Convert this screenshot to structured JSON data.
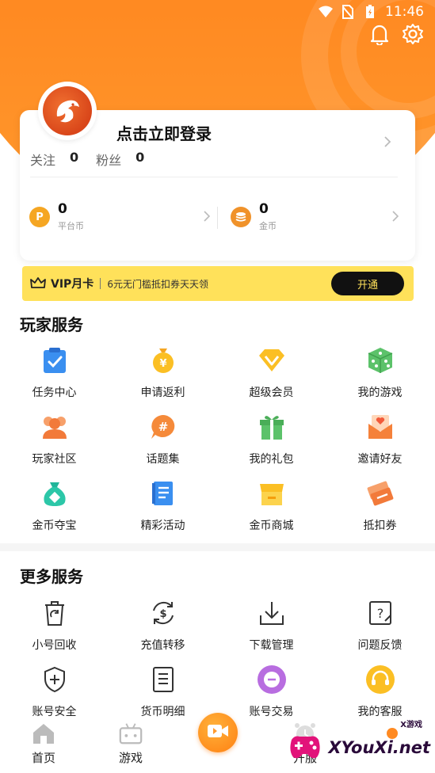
{
  "status_bar": {
    "time": "11:46"
  },
  "profile": {
    "login_prompt": "点击立即登录",
    "follow_label": "关注",
    "follow_count": "0",
    "fans_label": "粉丝",
    "fans_count": "0",
    "platform_coin_value": "0",
    "platform_coin_label": "平台币",
    "gold_coin_value": "0",
    "gold_coin_label": "金币"
  },
  "vip": {
    "title": "VIP月卡",
    "description": "6元无门槛抵扣券天天领",
    "button": "开通",
    "color": "#ffe15a"
  },
  "player_services": {
    "title": "玩家服务",
    "items": [
      {
        "label": "任务中心",
        "icon": "clipboard-check-icon"
      },
      {
        "label": "申请返利",
        "icon": "money-bag-icon"
      },
      {
        "label": "超级会员",
        "icon": "diamond-icon"
      },
      {
        "label": "我的游戏",
        "icon": "dice-icon"
      },
      {
        "label": "玩家社区",
        "icon": "community-icon"
      },
      {
        "label": "话题集",
        "icon": "topic-hash-icon"
      },
      {
        "label": "我的礼包",
        "icon": "gift-icon"
      },
      {
        "label": "邀请好友",
        "icon": "invite-envelope-icon"
      },
      {
        "label": "金币夺宝",
        "icon": "treasure-bag-icon"
      },
      {
        "label": "精彩活动",
        "icon": "activity-book-icon"
      },
      {
        "label": "金币商城",
        "icon": "store-icon"
      },
      {
        "label": "抵扣券",
        "icon": "coupon-icon"
      }
    ]
  },
  "more_services": {
    "title": "更多服务",
    "items": [
      {
        "label": "小号回收",
        "icon": "recycle-bin-icon"
      },
      {
        "label": "充值转移",
        "icon": "dollar-transfer-icon"
      },
      {
        "label": "下载管理",
        "icon": "download-icon"
      },
      {
        "label": "问题反馈",
        "icon": "feedback-icon"
      },
      {
        "label": "账号安全",
        "icon": "shield-icon"
      },
      {
        "label": "货币明细",
        "icon": "list-doc-icon"
      },
      {
        "label": "账号交易",
        "icon": "trade-icon"
      },
      {
        "label": "我的客服",
        "icon": "headset-icon"
      }
    ]
  },
  "bottom_nav": [
    {
      "label": "首页",
      "icon": "home-icon"
    },
    {
      "label": "游戏",
      "icon": "game-icon"
    },
    {
      "label": "",
      "icon": "video-icon"
    },
    {
      "label": "开服",
      "icon": "alarm-clock-icon"
    },
    {
      "label": "",
      "icon": "notification-dot-icon"
    }
  ],
  "watermark": {
    "text": "XYouXi.net",
    "small": "X游戏"
  },
  "colors": {
    "brand_orange": "#ff7a1a",
    "accent_yellow": "#ffe15a"
  }
}
